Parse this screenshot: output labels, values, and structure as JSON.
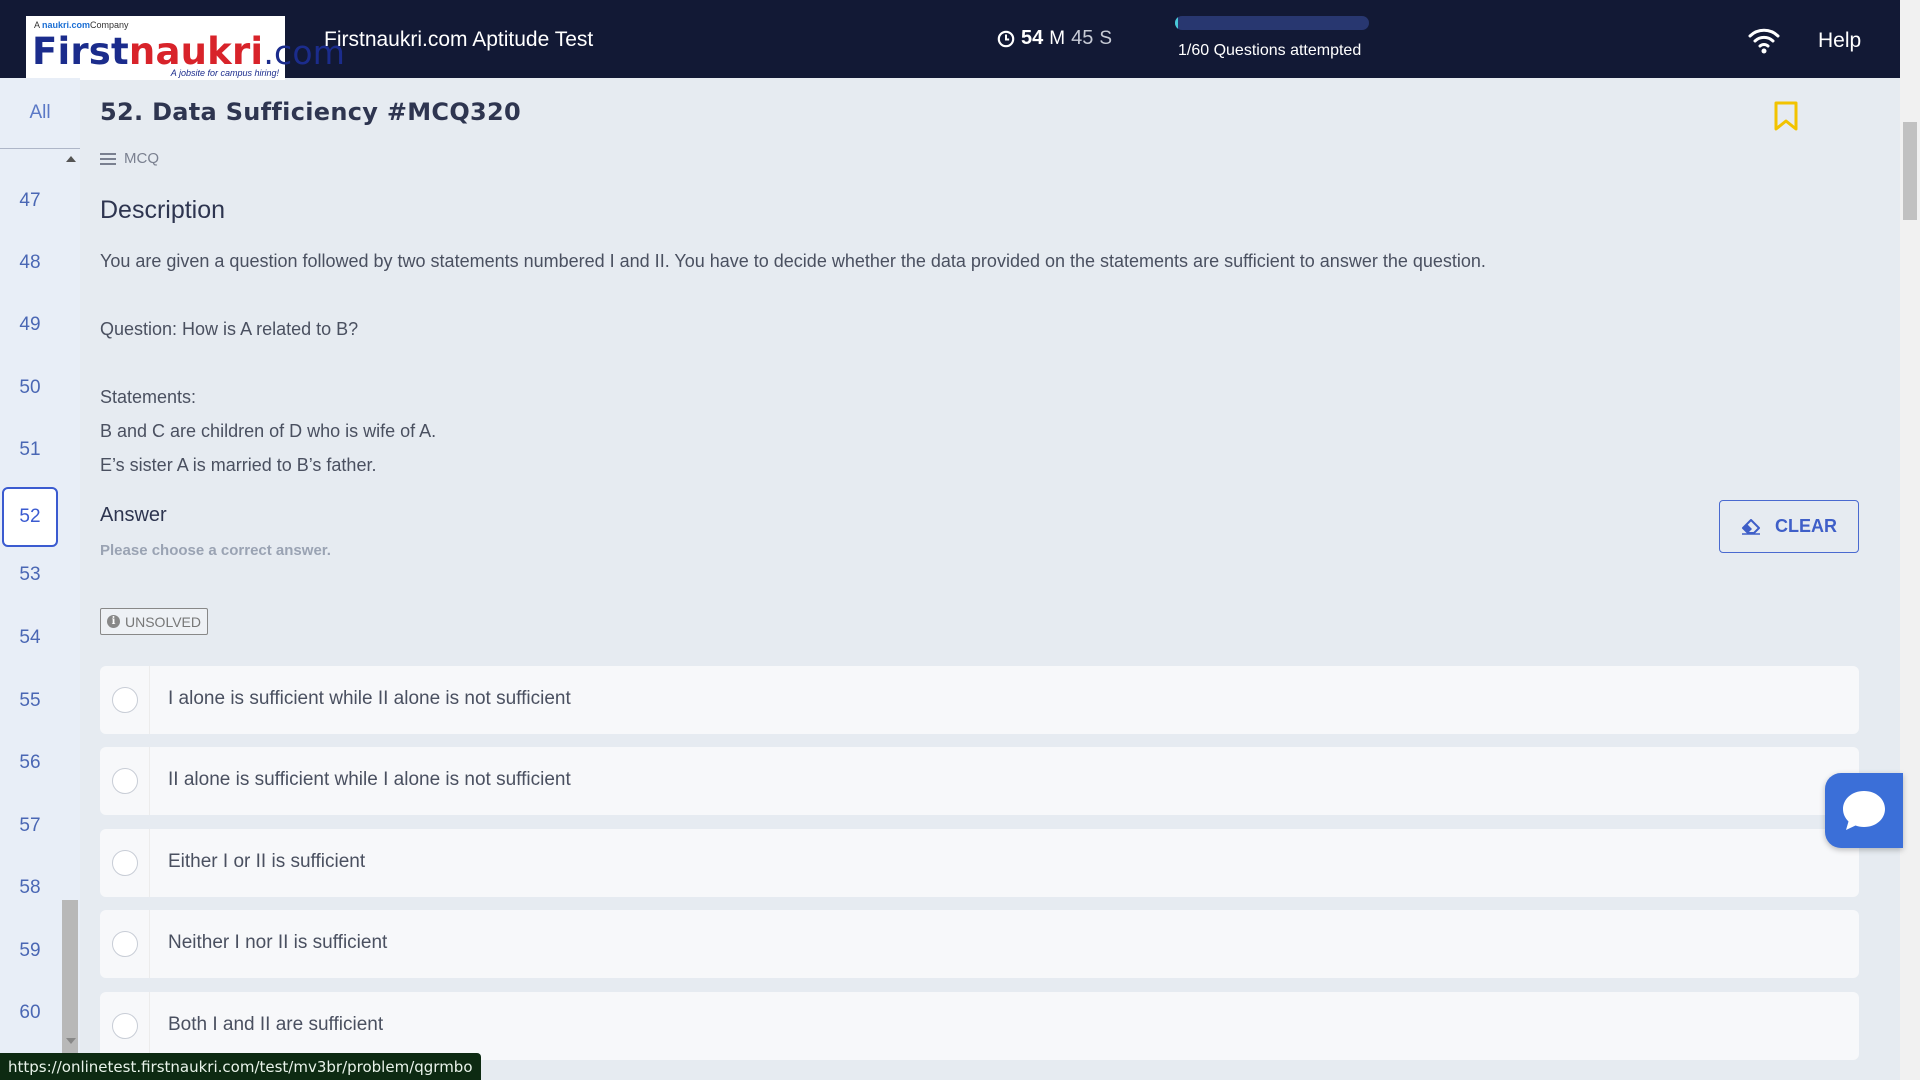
{
  "header": {
    "logo_tag_prefix": "A ",
    "logo_tag_brand": "naukri.com",
    "logo_tag_suffix": "Company",
    "logo_first": "First",
    "logo_naukri": "naukri",
    "logo_com": ".com",
    "logo_subtitle": "A jobsite for campus hiring!",
    "app_title": "Firstnaukri.com Aptitude Test",
    "timer_minutes": "54",
    "timer_min_unit": "M",
    "timer_seconds": "45",
    "timer_sec_unit": "S",
    "progress_fraction": 0.0167,
    "progress_text": "1/60 Questions attempted",
    "help_label": "Help"
  },
  "sidebar": {
    "all_label": "All",
    "items": [
      {
        "label": "47"
      },
      {
        "label": "48"
      },
      {
        "label": "49"
      },
      {
        "label": "50"
      },
      {
        "label": "51"
      },
      {
        "label": "52"
      },
      {
        "label": "53"
      },
      {
        "label": "54"
      },
      {
        "label": "55"
      },
      {
        "label": "56"
      },
      {
        "label": "57"
      },
      {
        "label": "58"
      },
      {
        "label": "59"
      },
      {
        "label": "60"
      }
    ],
    "active": "52"
  },
  "question": {
    "title": "52. Data Sufficiency #MCQ320",
    "type": "MCQ",
    "description_title": "Description",
    "description_intro": "You are given a question followed by two statements numbered I and II. You have to decide whether the data provided on the statements are sufficient to answer the question.",
    "question_line": "Question: How is A related to B?",
    "statements_label": "Statements:",
    "statement_1": "B and C are children of D who is wife of A.",
    "statement_2": "E’s sister A is married to B’s father.",
    "answer_title": "Answer",
    "answer_hint": "Please choose a correct answer.",
    "clear_label": "CLEAR",
    "status_badge": "UNSOLVED",
    "options": [
      {
        "text": "I alone is sufficient while II alone is not sufficient"
      },
      {
        "text": "II alone is sufficient while I alone is not sufficient"
      },
      {
        "text": "Either I or II is sufficient"
      },
      {
        "text": "Neither I nor II is sufficient"
      },
      {
        "text": "Both I and II are sufficient"
      }
    ]
  },
  "status_bar": {
    "url": "https://onlinetest.firstnaukri.com/test/mv3br/problem/qgrmbo"
  },
  "colors": {
    "header_bg": "#121935",
    "accent": "#3b5bd0",
    "bookmark": "#f2c300",
    "chat_bg": "#3b6fd8"
  }
}
